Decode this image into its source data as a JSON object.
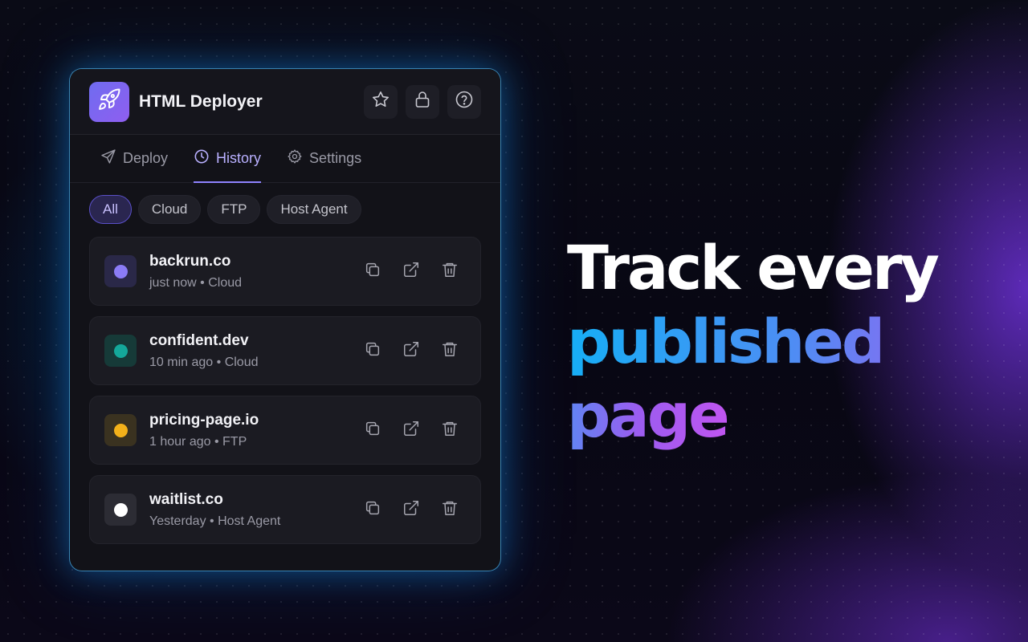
{
  "app": {
    "title": "HTML Deployer",
    "logo_icon": "rocket-icon",
    "header_buttons": [
      "star-icon",
      "lock-icon",
      "help-icon"
    ]
  },
  "tabs": [
    {
      "label": "Deploy",
      "icon": "send-icon",
      "active": false
    },
    {
      "label": "History",
      "icon": "clock-icon",
      "active": true
    },
    {
      "label": "Settings",
      "icon": "gear-icon",
      "active": false
    }
  ],
  "filters": [
    {
      "label": "All",
      "active": true
    },
    {
      "label": "Cloud",
      "active": false
    },
    {
      "label": "FTP",
      "active": false
    },
    {
      "label": "Host Agent",
      "active": false
    }
  ],
  "history": [
    {
      "domain": "backrun.co",
      "time": "just now",
      "target": "Cloud",
      "dot_color": "#8b7cf6",
      "tile_color": "#2a2848"
    },
    {
      "domain": "confident.dev",
      "time": "10 min ago",
      "target": "Cloud",
      "dot_color": "#14a89a",
      "tile_color": "#163a38"
    },
    {
      "domain": "pricing-page.io",
      "time": "1 hour ago",
      "target": "FTP",
      "dot_color": "#f3b11a",
      "tile_color": "#3a3220"
    },
    {
      "domain": "waitlist.co",
      "time": "Yesterday",
      "target": "Host Agent",
      "dot_color": "#ffffff",
      "tile_color": "#2c2c34"
    }
  ],
  "meta_separator": "•",
  "row_actions": [
    "copy-icon",
    "external-link-icon",
    "trash-icon"
  ],
  "headline": {
    "line1": "Track every",
    "line2_word1": "published",
    "line2_word2": "page"
  }
}
